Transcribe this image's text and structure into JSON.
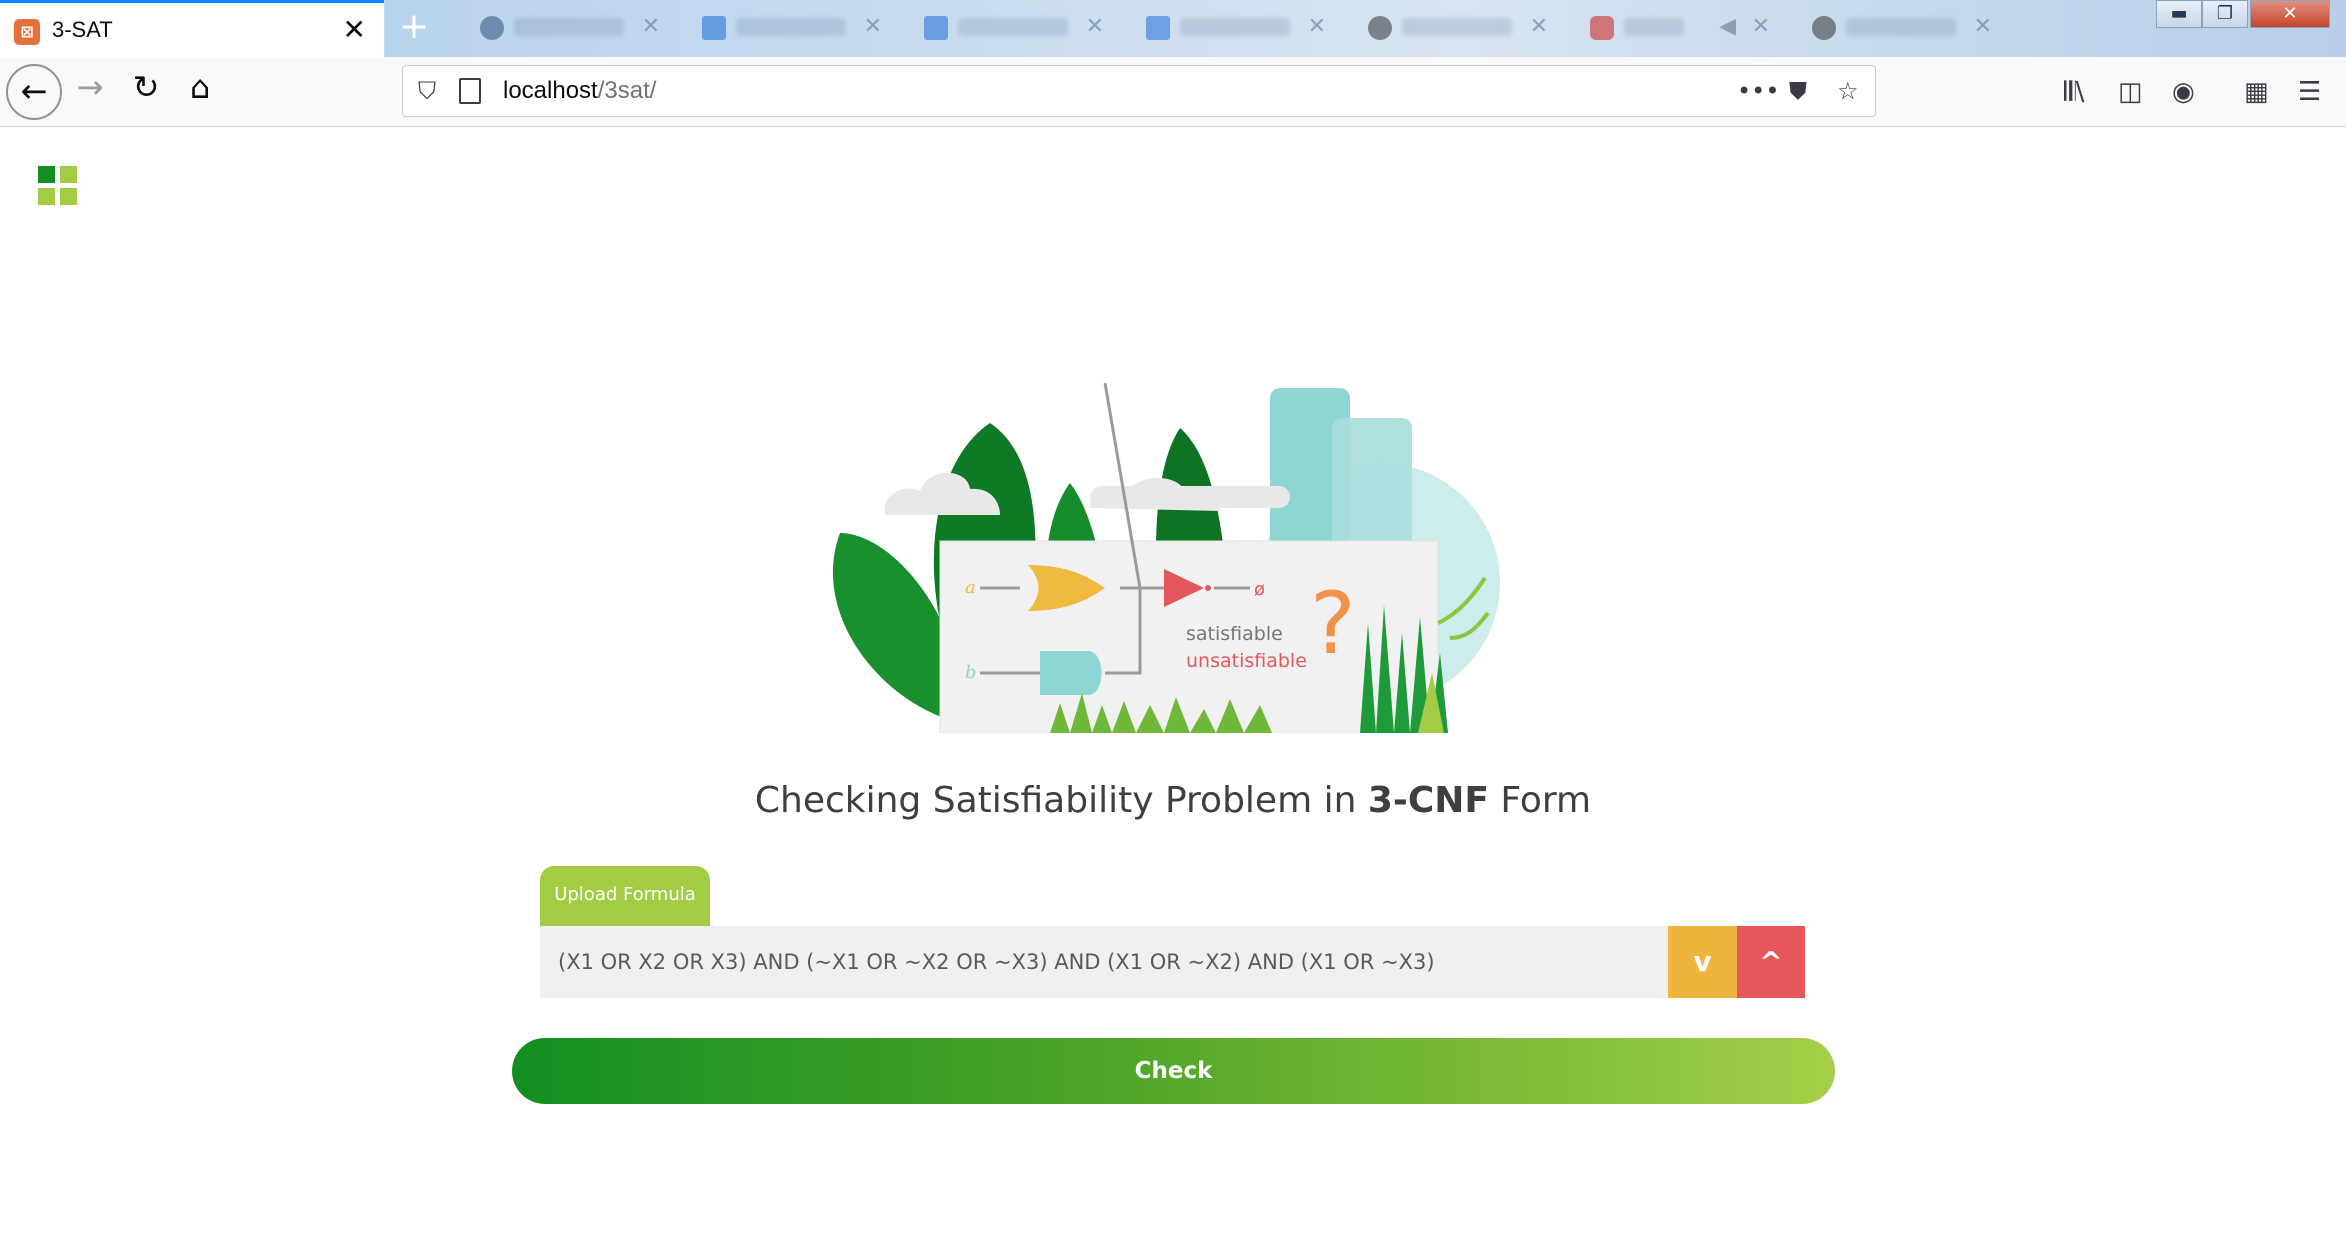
{
  "browser": {
    "active_tab": {
      "title": "3-SAT",
      "favicon": "xampp-icon",
      "close": "✕"
    },
    "new_tab": "+",
    "background_tab_colors": [
      "#33507a",
      "#1e6fd9",
      "#1e6fd9",
      "#1e6fd9",
      "#333333",
      "#cc1f1f",
      "#333333"
    ],
    "url": {
      "host": "localhost",
      "path": "/3sat/"
    },
    "nav": {
      "back": "←",
      "forward": "→",
      "reload": "↻",
      "home": "⌂"
    },
    "window": {
      "minimize": "▬",
      "restore": "❐",
      "close": "✕"
    }
  },
  "page": {
    "headline": {
      "prefix": "Checking Satisfiability Problem in ",
      "bold": "3-CNF",
      "suffix": " Form"
    },
    "illustration": {
      "label_sat": "satisfiable",
      "label_unsat": "unsatisfiable",
      "input_a": "a",
      "input_b": "b",
      "output": "ø",
      "question": "?"
    },
    "upload_tab": "Upload Formula",
    "formula_value": "(X1 OR X2 OR X3) AND (~X1 OR ~X2 OR ~X3) AND (X1 OR ~X2) AND (X1 OR ~X3)",
    "down_button": "v",
    "up_button": "^",
    "check_button": "Check"
  },
  "colors": {
    "brand_green": "#138e22",
    "light_green": "#a3cc45",
    "amber": "#efb43c",
    "red": "#e5575b",
    "teal": "#8fd6d3"
  }
}
